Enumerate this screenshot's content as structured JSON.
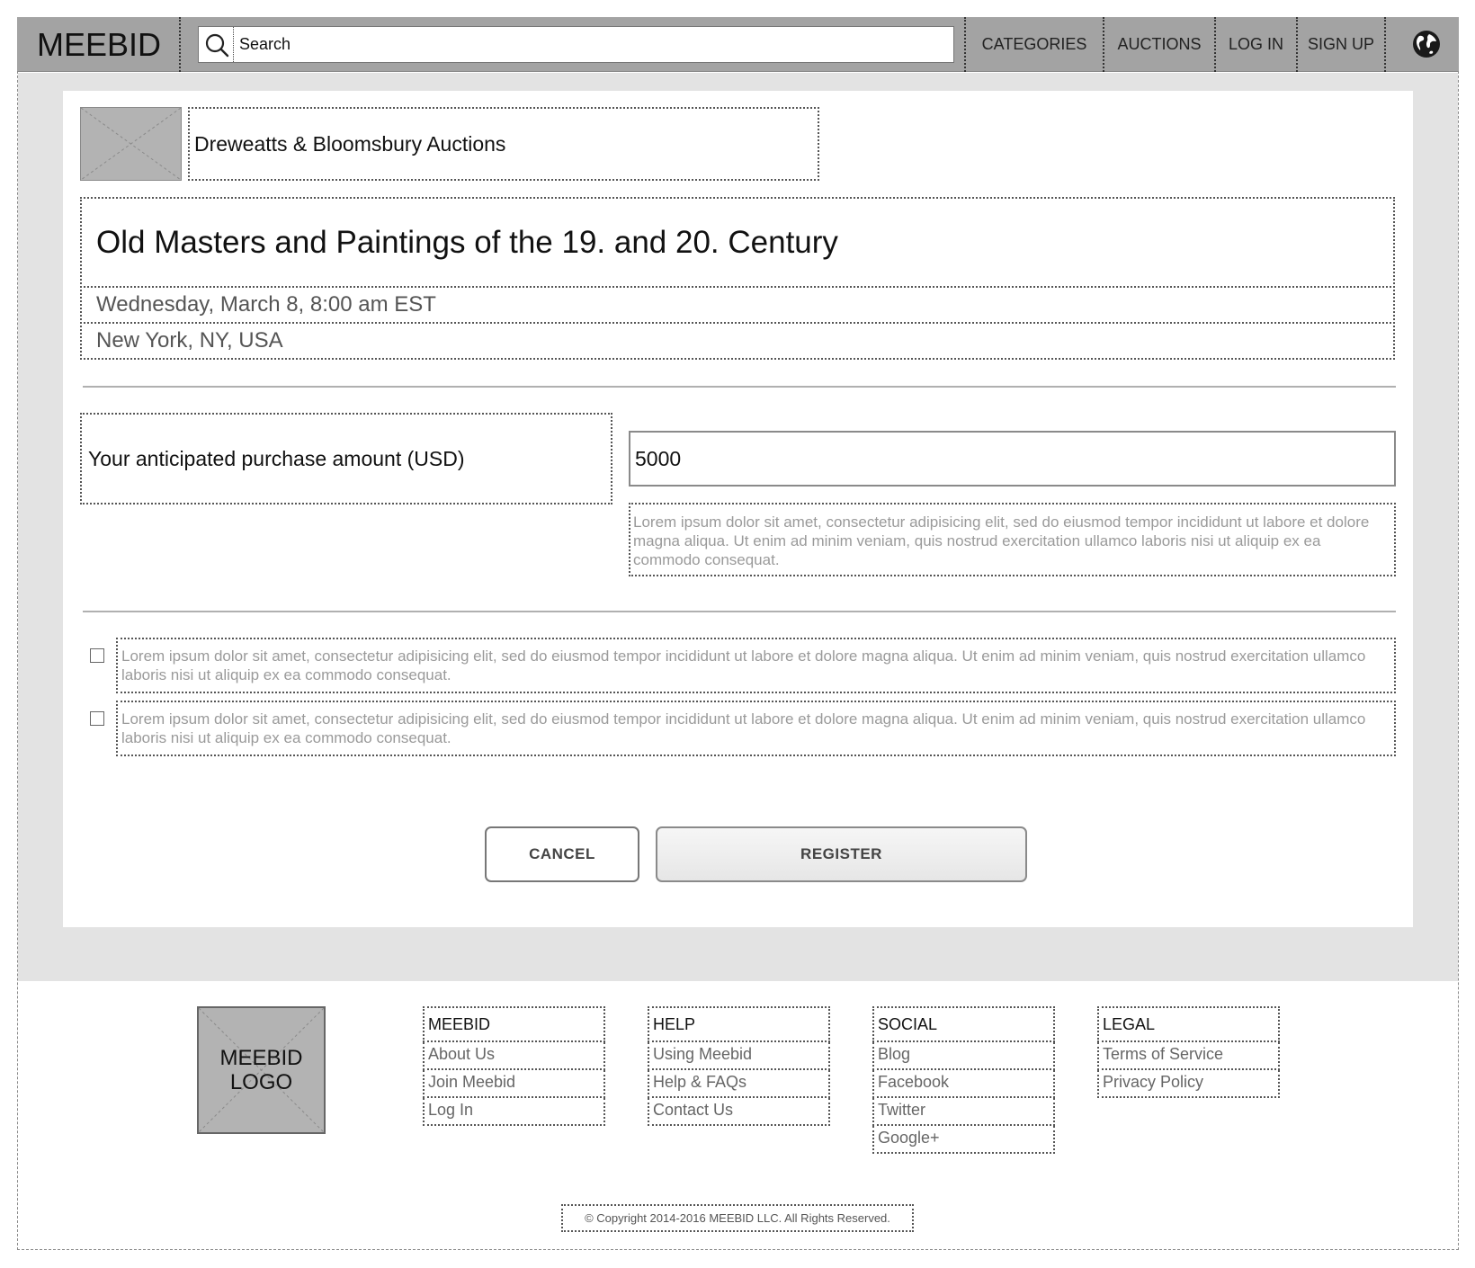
{
  "header": {
    "brand": "MEEBID",
    "search_placeholder": "Search",
    "nav": [
      "CATEGORIES",
      "AUCTIONS",
      "LOG IN",
      "SIGN UP"
    ]
  },
  "auction": {
    "house": "Dreweatts & Bloomsbury Auctions",
    "title": "Old Masters and Paintings of the 19. and 20. Century",
    "date": "Wednesday, March 8, 8:00 am EST",
    "location": "New York, NY, USA"
  },
  "form": {
    "amount_label": "Your anticipated purchase amount (USD)",
    "amount_value": "5000",
    "amount_help": "Lorem ipsum dolor sit amet, consectetur adipisicing elit, sed do eiusmod tempor incididunt ut labore et dolore magna aliqua. Ut enim ad minim veniam, quis nostrud exercitation ullamco laboris nisi ut aliquip ex ea commodo consequat.",
    "checkboxes": [
      {
        "text": "Lorem ipsum dolor sit amet, consectetur adipisicing elit, sed do eiusmod tempor incididunt ut labore et dolore magna aliqua. Ut enim ad minim veniam, quis nostrud exercitation ullamco laboris nisi ut aliquip ex ea commodo consequat.",
        "checked": false
      },
      {
        "text": "Lorem ipsum dolor sit amet, consectetur adipisicing elit, sed do eiusmod tempor incididunt ut labore et dolore magna aliqua. Ut enim ad minim veniam, quis nostrud exercitation ullamco laboris nisi ut aliquip ex ea commodo consequat.",
        "checked": false
      }
    ],
    "cancel_label": "CANCEL",
    "register_label": "REGISTER"
  },
  "footer": {
    "logo_text": "MEEBID\nLOGO",
    "columns": [
      {
        "heading": "MEEBID",
        "links": [
          "About Us",
          "Join Meebid",
          "Log In"
        ]
      },
      {
        "heading": "HELP",
        "links": [
          "Using Meebid",
          "Help & FAQs",
          "Contact Us"
        ]
      },
      {
        "heading": "SOCIAL",
        "links": [
          "Blog",
          "Facebook",
          "Twitter",
          "Google+"
        ]
      },
      {
        "heading": "LEGAL",
        "links": [
          "Terms of Service",
          "Privacy Policy"
        ]
      }
    ],
    "copyright": "© Copyright 2014-2016 MEEBID LLC. All Rights Reserved."
  },
  "colors": {
    "topbar": "#a3a3a3",
    "band": "#e3e3e3",
    "placeholder_image": "#b3b3b3",
    "muted_text": "#9a9a9a"
  },
  "icons": [
    "search-icon",
    "globe-icon",
    "image-placeholder-icon"
  ]
}
